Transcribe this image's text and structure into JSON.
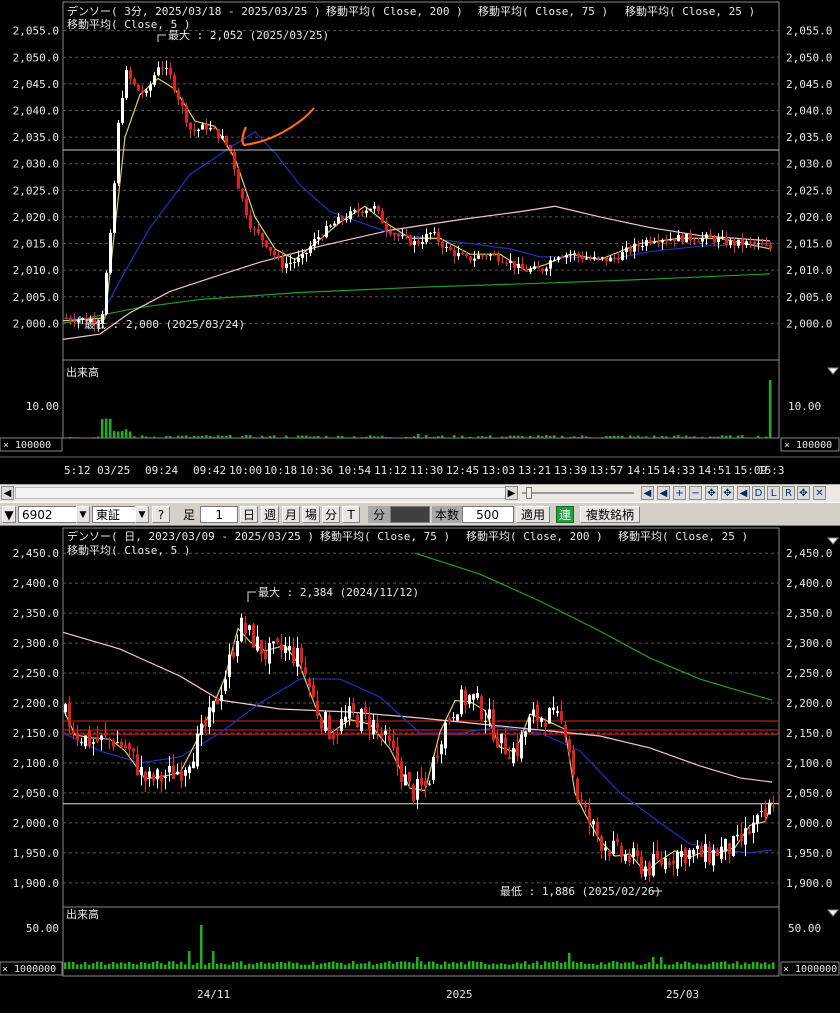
{
  "top_chart": {
    "title": "デンソー( 3分, 2025/03/18 - 2025/03/25 )",
    "ma_labels": [
      "移動平均( Close, 200 )",
      "移動平均( Close, 75 )",
      "移動平均( Close, 25 )",
      "移動平均( Close, 5 )"
    ],
    "max_label": "最大 : 2,052 (2025/03/25)",
    "min_label": "最低 : 2,000 (2025/03/24)",
    "volume_label": "出来高",
    "volume_scale": "10.00",
    "volume_unit": "× 100000",
    "y_ticks": [
      "2,055.0",
      "2,050.0",
      "2,045.0",
      "2,040.0",
      "2,035.0",
      "2,030.0",
      "2,025.0",
      "2,020.0",
      "2,015.0",
      "2,010.0",
      "2,005.0",
      "2,000.0"
    ],
    "x_ticks": [
      "5:12 03/25",
      "09:24",
      "09:42",
      "10:00",
      "10:18",
      "10:36",
      "10:54",
      "11:12",
      "11:30",
      "12:45",
      "13:03",
      "13:21",
      "13:39",
      "13:57",
      "14:15",
      "14:33",
      "14:51",
      "15:09",
      "15:3"
    ]
  },
  "toolbar": {
    "code": "6902",
    "market": "東証",
    "help": "?",
    "ashi": "足",
    "ashi_value": "1",
    "day": "日",
    "week": "週",
    "month": "月",
    "ba": "場",
    "fun": "分",
    "t": "T",
    "fun2": "分",
    "honsu": "本数",
    "honsu_value": "500",
    "apply": "適用",
    "ren": "連",
    "multi": "複数銘柄"
  },
  "nav_buttons": [
    "◀",
    "◀",
    "+",
    "−",
    "✥",
    "✥",
    "◀",
    "D",
    "L",
    "R",
    "✥",
    "✕"
  ],
  "bottom_chart": {
    "title": "デンソー( 日, 2023/03/09 - 2025/03/25 )",
    "ma_labels": [
      "移動平均( Close, 75 )",
      "移動平均( Close, 200 )",
      "移動平均( Close, 25 )",
      "移動平均( Close, 5 )"
    ],
    "max_label": "最大 : 2,384 (2024/11/12)",
    "min_label": "最低 : 1,886 (2025/02/26)",
    "volume_label": "出来高",
    "volume_scale": "50.00",
    "volume_unit": "× 1000000",
    "y_ticks": [
      "2,450.0",
      "2,400.0",
      "2,350.0",
      "2,300.0",
      "2,250.0",
      "2,200.0",
      "2,150.0",
      "2,100.0",
      "2,050.0",
      "2,000.0",
      "1,950.0",
      "1,900.0"
    ],
    "x_ticks": [
      "24/11",
      "2025",
      "25/03"
    ]
  },
  "chart_data": [
    {
      "type": "candlestick",
      "title": "デンソー( 3分, 2025/03/18 - 2025/03/25 )",
      "ylim": [
        1995,
        2057
      ],
      "series": [
        {
          "name": "移動平均( Close, 200 )",
          "color": "#20a020"
        },
        {
          "name": "移動平均( Close, 75 )",
          "color": "#f0c8c8"
        },
        {
          "name": "移動平均( Close, 25 )",
          "color": "#2030c0"
        },
        {
          "name": "移動平均( Close, 5 )",
          "color": "#d8d060"
        }
      ],
      "max": 2052,
      "min": 2000,
      "hline": 2031.7
    },
    {
      "type": "candlestick",
      "title": "デンソー( 日, 2023/03/09 - 2025/03/25 )",
      "ylim": [
        1878,
        2462
      ],
      "series": [
        {
          "name": "移動平均( Close, 75 )",
          "color": "#f0c8c8"
        },
        {
          "name": "移動平均( Close, 200 )",
          "color": "#20a020"
        },
        {
          "name": "移動平均( Close, 25 )",
          "color": "#2030c0"
        },
        {
          "name": "移動平均( Close, 5 )",
          "color": "#d8d060"
        }
      ],
      "max": 2384,
      "min": 1886,
      "hlines_red": [
        2170,
        2155,
        2148
      ],
      "hline_white": 2032
    }
  ]
}
